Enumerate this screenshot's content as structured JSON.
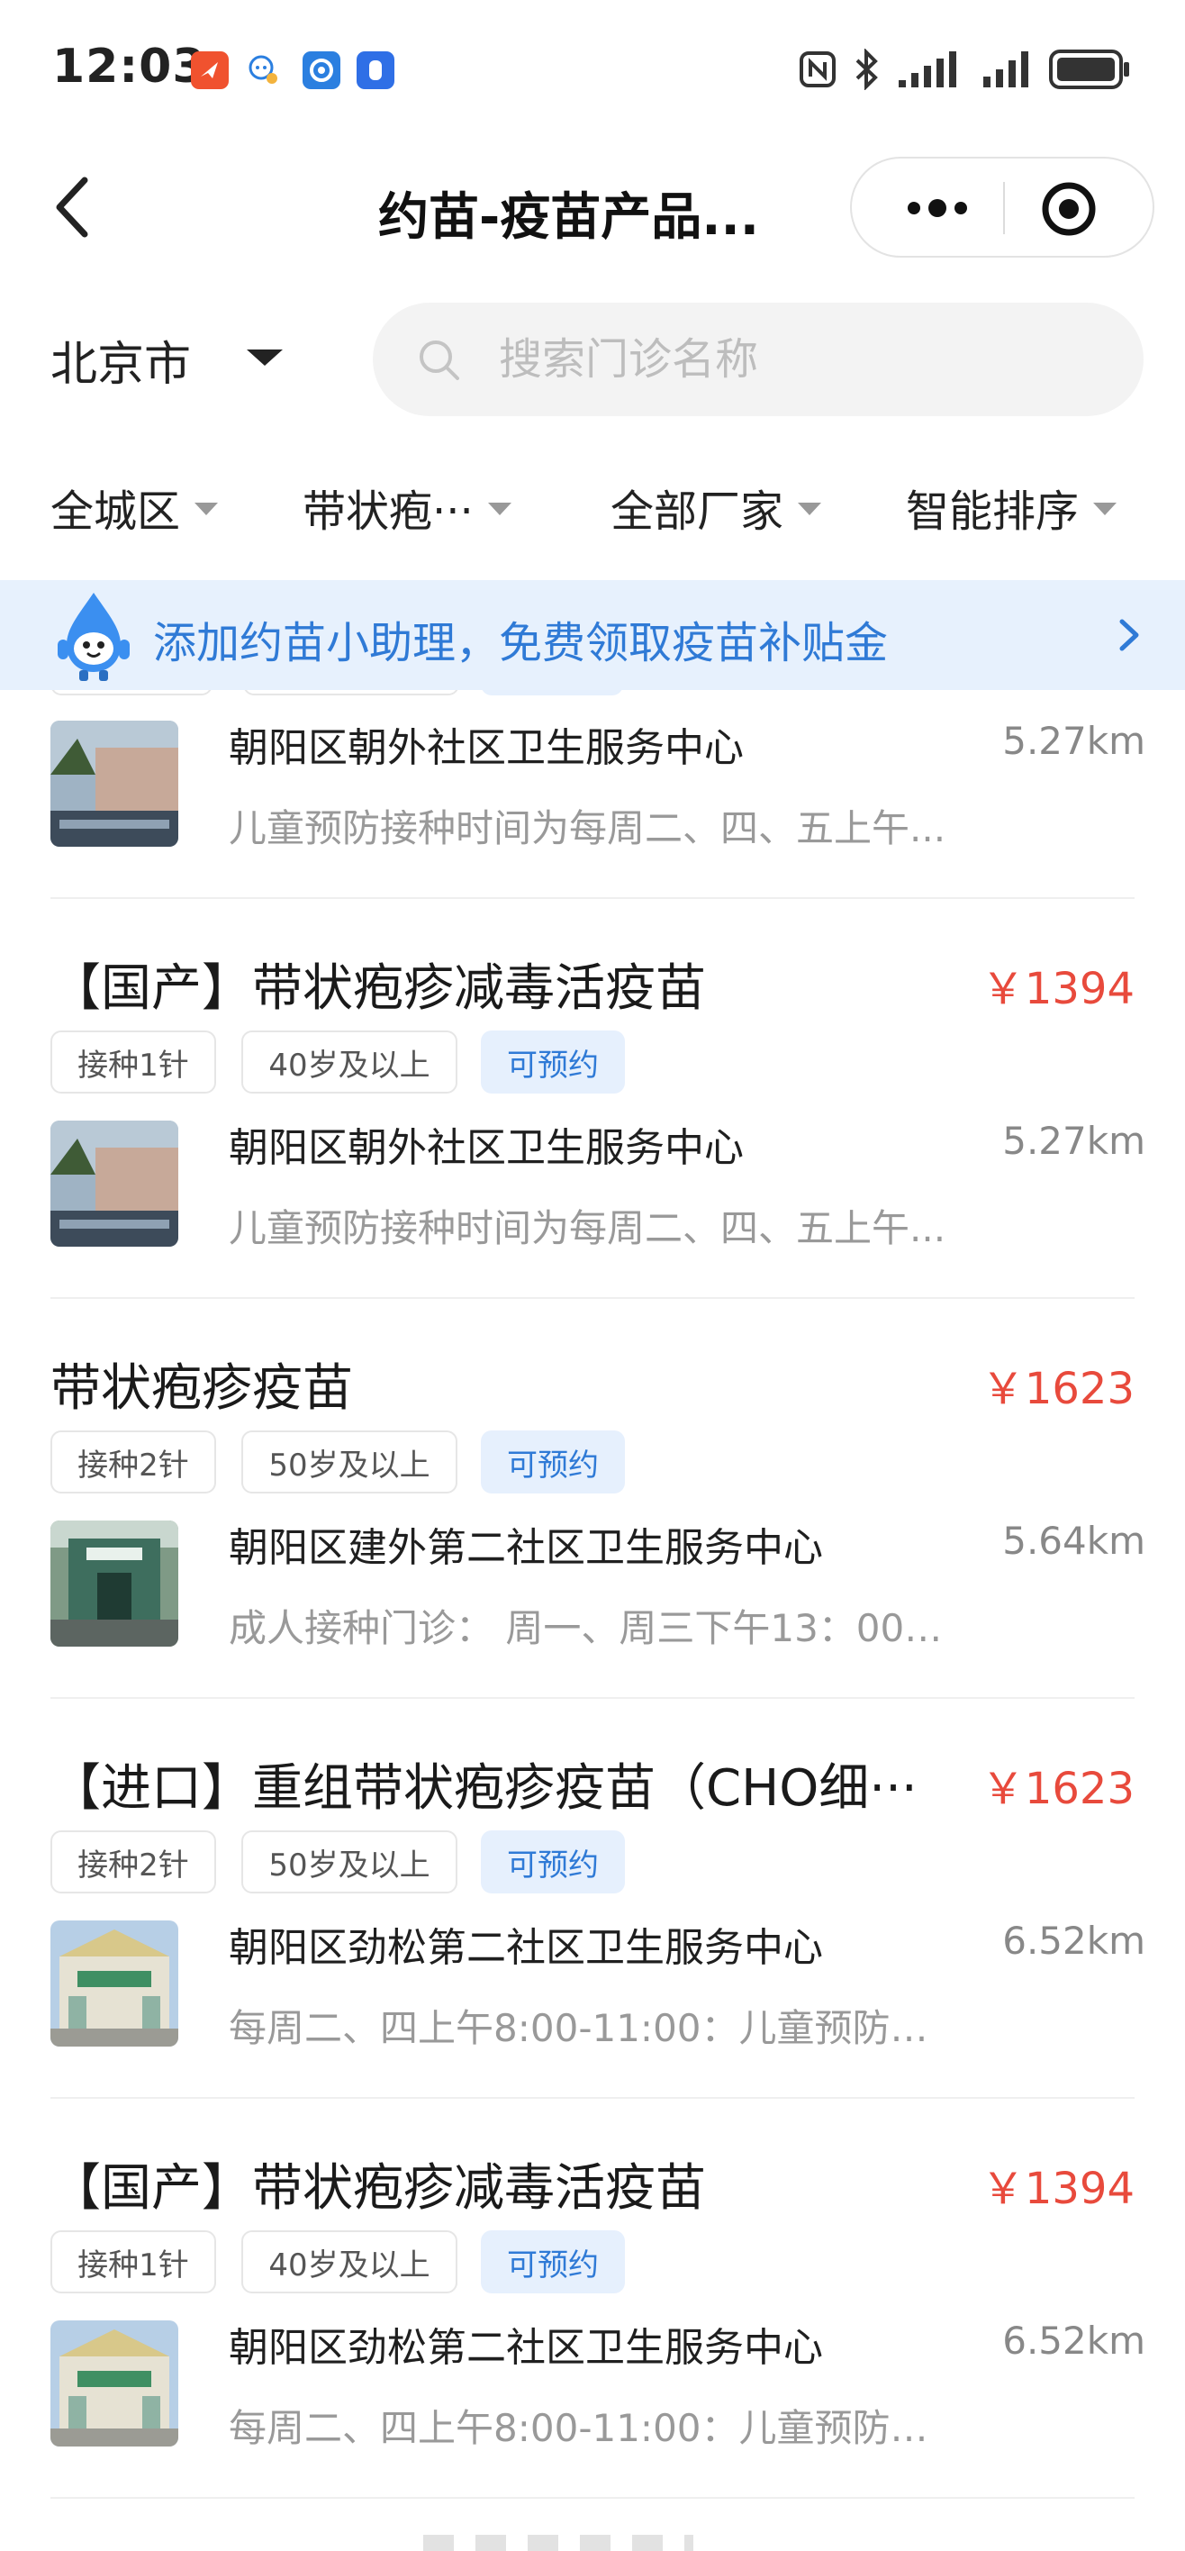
{
  "status_bar": {
    "time": "12:03",
    "apps": [
      {
        "icon": "red-app-icon",
        "color": "#f0522f"
      },
      {
        "icon": "chat-bubble-app-icon",
        "color": "#ffffff"
      },
      {
        "icon": "blue-circle-app-icon",
        "color": "#2b7fe0"
      },
      {
        "icon": "blue-hand-app-icon",
        "color": "#2f6fe6"
      }
    ],
    "indicators": [
      "nfc-icon",
      "bluetooth-icon",
      "signal-icon",
      "signal-icon",
      "battery-icon"
    ]
  },
  "nav": {
    "title": "约苗-疫苗产品...",
    "back_icon": "chevron-left-icon",
    "more_icon": "more-dots-icon",
    "close_icon": "target-circle-icon"
  },
  "location": {
    "city": "北京市"
  },
  "search": {
    "placeholder": "搜索门诊名称"
  },
  "filters": [
    {
      "label": "全城区"
    },
    {
      "label": "带状疱···"
    },
    {
      "label": "全部厂家"
    },
    {
      "label": "智能排序"
    }
  ],
  "banner": {
    "text": "添加约苗小助理，免费领取疫苗补贴金"
  },
  "partial_card": {
    "clinic": "朝阳区朝外社区卫生服务中心",
    "distance": "5.27km",
    "hours": "儿童预防接种时间为每周二、四、五上午..."
  },
  "cards": [
    {
      "title": "【国产】带状疱疹减毒活疫苗",
      "price": "￥1394",
      "tags": [
        "接种1针",
        "40岁及以上",
        "可预约"
      ],
      "clinic": "朝阳区朝外社区卫生服务中心",
      "distance": "5.27km",
      "hours": "儿童预防接种时间为每周二、四、五上午..."
    },
    {
      "title": "带状疱疹疫苗",
      "price": "￥1623",
      "tags": [
        "接种2针",
        "50岁及以上",
        "可预约"
      ],
      "clinic": "朝阳区建外第二社区卫生服务中心",
      "distance": "5.64km",
      "hours": "成人接种门诊：  周一、周三下午13：00-..."
    },
    {
      "title": "【进口】重组带状疱疹疫苗（CHO细···",
      "price": "￥1623",
      "tags": [
        "接种2针",
        "50岁及以上",
        "可预约"
      ],
      "clinic": "朝阳区劲松第二社区卫生服务中心",
      "distance": "6.52km",
      "hours": "每周二、四上午8:00-11:00：儿童预防接..."
    },
    {
      "title": "【国产】带状疱疹减毒活疫苗",
      "price": "￥1394",
      "tags": [
        "接种1针",
        "40岁及以上",
        "可预约"
      ],
      "clinic": "朝阳区劲松第二社区卫生服务中心",
      "distance": "6.52km",
      "hours": "每周二、四上午8:00-11:00：儿童预防接..."
    }
  ]
}
